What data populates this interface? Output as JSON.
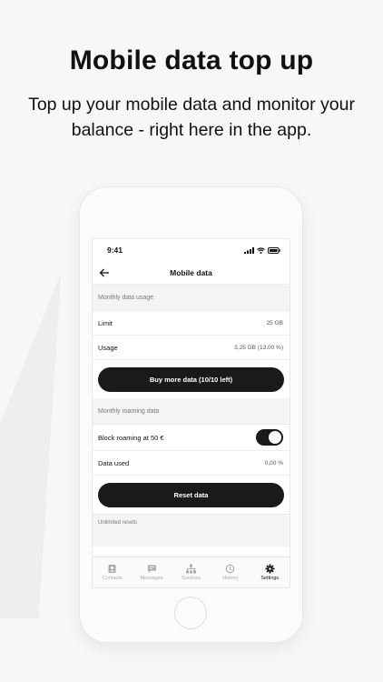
{
  "promo": {
    "title": "Mobile data top up",
    "subtitle": "Top up your mobile data and monitor your balance - right here in the app."
  },
  "status_bar": {
    "time": "9:41"
  },
  "nav": {
    "title": "Mobile data"
  },
  "data_usage": {
    "header": "Monthly data usage",
    "limit_label": "Limit",
    "limit_value": "25 GB",
    "usage_label": "Usage",
    "usage_value": "3,25 GB (13.00 %)",
    "buy_button": "Buy more data (10/10 left)"
  },
  "roaming": {
    "header": "Monthly roaming data",
    "block_label": "Block roaming at 50 €",
    "block_enabled": true,
    "used_label": "Data used",
    "used_value": "0,00 %",
    "reset_button": "Reset data",
    "footnote": "Unlimited resets"
  },
  "tabs": [
    {
      "label": "Contacts",
      "icon": "contacts-icon",
      "active": false
    },
    {
      "label": "Messages",
      "icon": "messages-icon",
      "active": false
    },
    {
      "label": "Services",
      "icon": "services-icon",
      "active": false
    },
    {
      "label": "History",
      "icon": "history-icon",
      "active": false
    },
    {
      "label": "Settings",
      "icon": "settings-icon",
      "active": true
    }
  ],
  "colors": {
    "accent": "#1a1a1a",
    "background": "#f7f7f7"
  }
}
